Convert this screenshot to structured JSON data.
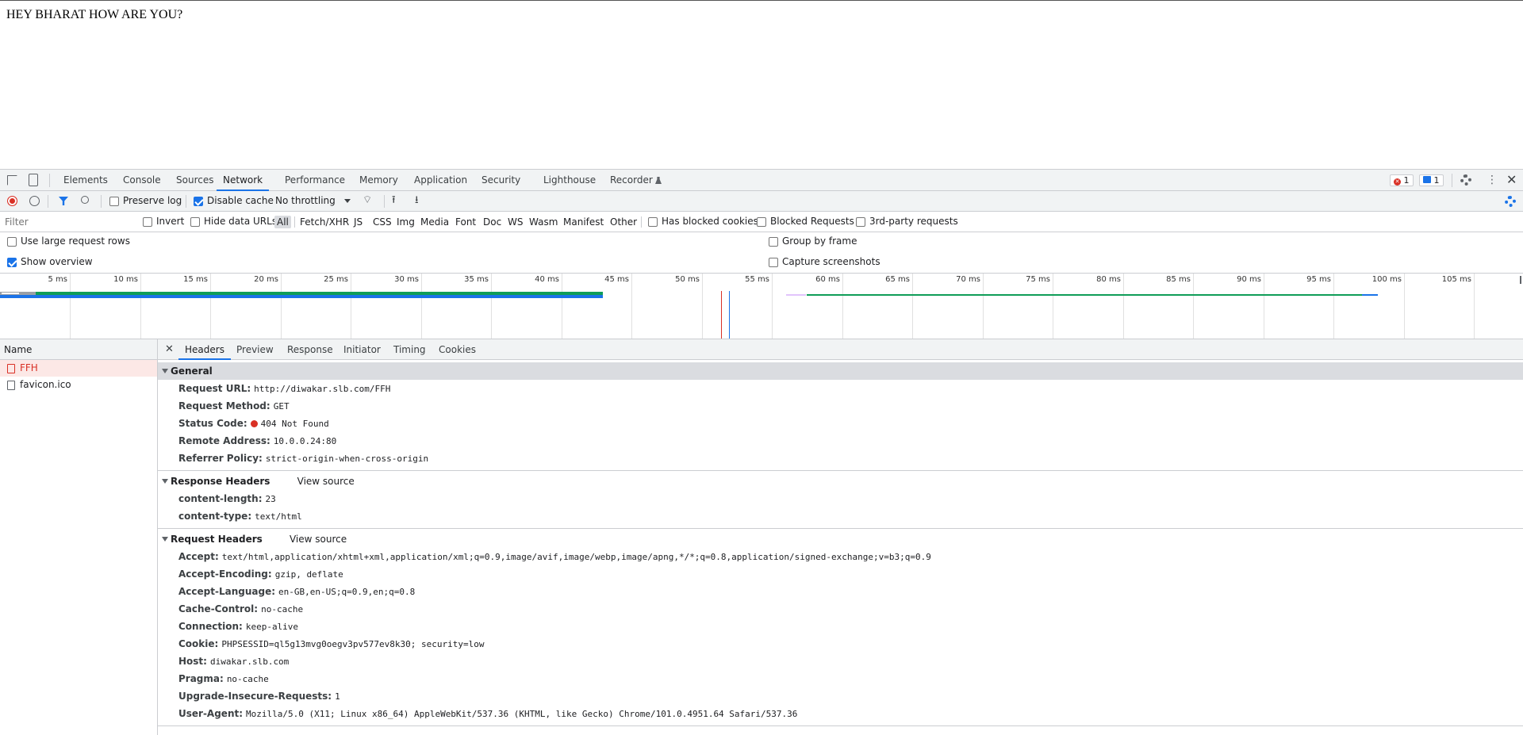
{
  "page": {
    "text": "HEY BHARAT HOW ARE YOU?"
  },
  "devtools": {
    "tabs": [
      {
        "label": "Elements"
      },
      {
        "label": "Console"
      },
      {
        "label": "Sources"
      },
      {
        "label": "Network"
      },
      {
        "label": "Performance"
      },
      {
        "label": "Memory"
      },
      {
        "label": "Application"
      },
      {
        "label": "Security"
      },
      {
        "label": "Lighthouse"
      },
      {
        "label": "Recorder"
      }
    ],
    "active_tab": "Network",
    "error_count": "1",
    "message_count": "1"
  },
  "toolbar": {
    "preserve_log": "Preserve log",
    "disable_cache": "Disable cache",
    "throttling": "No throttling"
  },
  "filter": {
    "placeholder": "Filter",
    "invert": "Invert",
    "hide_data_urls": "Hide data URLs",
    "types": [
      "All",
      "Fetch/XHR",
      "JS",
      "CSS",
      "Img",
      "Media",
      "Font",
      "Doc",
      "WS",
      "Wasm",
      "Manifest",
      "Other"
    ],
    "has_blocked_cookies": "Has blocked cookies",
    "blocked_requests": "Blocked Requests",
    "third_party": "3rd-party requests"
  },
  "options": {
    "large_rows": "Use large request rows",
    "show_overview": "Show overview",
    "group_by_frame": "Group by frame",
    "capture_screenshots": "Capture screenshots"
  },
  "overview": {
    "ticks": [
      "5 ms",
      "10 ms",
      "15 ms",
      "20 ms",
      "25 ms",
      "30 ms",
      "35 ms",
      "40 ms",
      "45 ms",
      "50 ms",
      "55 ms",
      "60 ms",
      "65 ms",
      "70 ms",
      "75 ms",
      "80 ms",
      "85 ms",
      "90 ms",
      "95 ms",
      "100 ms",
      "105 ms"
    ]
  },
  "requests": {
    "header": "Name",
    "items": [
      {
        "name": "FFH"
      },
      {
        "name": "favicon.ico"
      }
    ]
  },
  "details": {
    "tabs": [
      {
        "label": "Headers"
      },
      {
        "label": "Preview"
      },
      {
        "label": "Response"
      },
      {
        "label": "Initiator"
      },
      {
        "label": "Timing"
      },
      {
        "label": "Cookies"
      }
    ],
    "general": {
      "title": "General",
      "rows": [
        {
          "k": "Request URL:",
          "v": "http://diwakar.slb.com/FFH"
        },
        {
          "k": "Request Method:",
          "v": "GET"
        },
        {
          "k": "Status Code:",
          "v": "404 Not Found"
        },
        {
          "k": "Remote Address:",
          "v": "10.0.0.24:80"
        },
        {
          "k": "Referrer Policy:",
          "v": "strict-origin-when-cross-origin"
        }
      ]
    },
    "response_headers": {
      "title": "Response Headers",
      "view_source": "View source",
      "rows": [
        {
          "k": "content-length:",
          "v": "23"
        },
        {
          "k": "content-type:",
          "v": "text/html"
        }
      ]
    },
    "request_headers": {
      "title": "Request Headers",
      "view_source": "View source",
      "rows": [
        {
          "k": "Accept:",
          "v": "text/html,application/xhtml+xml,application/xml;q=0.9,image/avif,image/webp,image/apng,*/*;q=0.8,application/signed-exchange;v=b3;q=0.9"
        },
        {
          "k": "Accept-Encoding:",
          "v": "gzip, deflate"
        },
        {
          "k": "Accept-Language:",
          "v": "en-GB,en-US;q=0.9,en;q=0.8"
        },
        {
          "k": "Cache-Control:",
          "v": "no-cache"
        },
        {
          "k": "Connection:",
          "v": "keep-alive"
        },
        {
          "k": "Cookie:",
          "v": "PHPSESSID=ql5g13mvg0oegv3pv577ev8k30; security=low"
        },
        {
          "k": "Host:",
          "v": "diwakar.slb.com"
        },
        {
          "k": "Pragma:",
          "v": "no-cache"
        },
        {
          "k": "Upgrade-Insecure-Requests:",
          "v": "1"
        },
        {
          "k": "User-Agent:",
          "v": "Mozilla/5.0 (X11; Linux x86_64) AppleWebKit/537.36 (KHTML, like Gecko) Chrome/101.0.4951.64 Safari/537.36"
        }
      ]
    }
  },
  "colors": {
    "accent": "#1a73e8",
    "error": "#d93025",
    "bar_green": "#0f9d58",
    "bar_blue": "#1a73e8"
  }
}
